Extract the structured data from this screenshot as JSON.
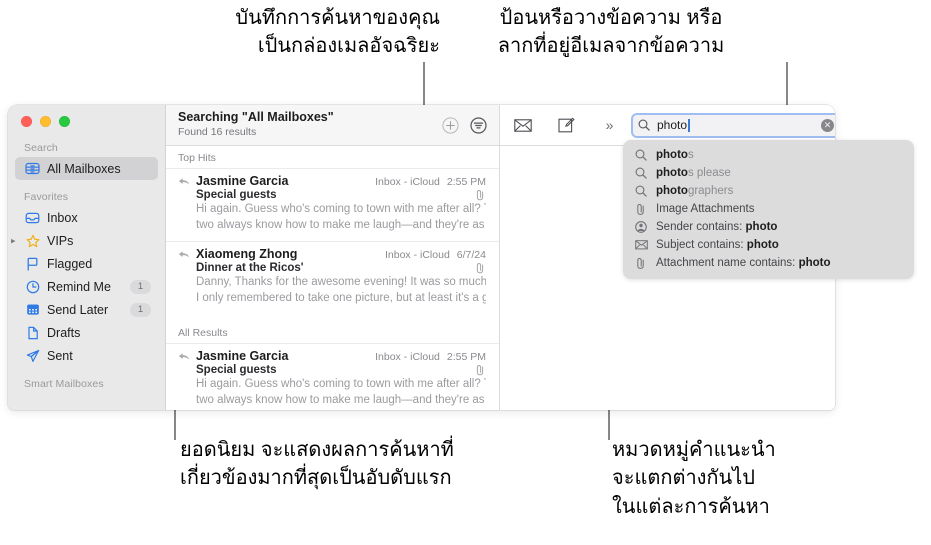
{
  "callouts": {
    "top_left": "บันทึกการค้นหาของคุณ\nเป็นกล่องเมลอัจฉริยะ",
    "top_right": "ป้อนหรือวางข้อความ หรือ\nลากที่อยู่อีเมลจากข้อความ",
    "bottom_left": "ยอดนิยม จะแสดงผลการค้นหาที่\nเกี่ยวข้องมากที่สุดเป็นอับดับแรก",
    "bottom_right": "หมวดหมู่คำแนะนำ\nจะแตกต่างกันไป\nในแต่ละการค้นหา"
  },
  "window": {
    "traffic_lights": [
      "close",
      "minimize",
      "zoom"
    ],
    "colors": {
      "accent_blue": "#2f7ae5",
      "focus_ring": "#9fbdf0",
      "sidebar_bg": "#e9e9e9",
      "selected_row": "#d2d2d4",
      "popup_bg": "#dcdcdc",
      "traffic_red": "#ff5f57",
      "traffic_yellow": "#febc2e",
      "traffic_green": "#28c840"
    }
  },
  "sidebar": {
    "sections": [
      {
        "header": "Search",
        "items": [
          {
            "label": "All Mailboxes",
            "icon": "mailbox-stack-icon",
            "selected": true,
            "badge": "",
            "disclosure": false
          }
        ]
      },
      {
        "header": "Favorites",
        "items": [
          {
            "label": "Inbox",
            "icon": "inbox-tray-icon",
            "selected": false,
            "badge": "",
            "disclosure": false
          },
          {
            "label": "VIPs",
            "icon": "star-icon",
            "selected": false,
            "badge": "",
            "disclosure": true
          },
          {
            "label": "Flagged",
            "icon": "flag-icon",
            "selected": false,
            "badge": "",
            "disclosure": false
          },
          {
            "label": "Remind Me",
            "icon": "clock-icon",
            "selected": false,
            "badge": "1",
            "disclosure": false
          },
          {
            "label": "Send Later",
            "icon": "calendar-icon",
            "selected": false,
            "badge": "1",
            "disclosure": false
          },
          {
            "label": "Drafts",
            "icon": "document-icon",
            "selected": false,
            "badge": "",
            "disclosure": false
          },
          {
            "label": "Sent",
            "icon": "paper-plane-icon",
            "selected": false,
            "badge": "",
            "disclosure": false
          }
        ]
      },
      {
        "header": "Smart Mailboxes",
        "items": []
      }
    ]
  },
  "list_header": {
    "title": "Searching \"All Mailboxes\"",
    "subtitle": "Found 16 results",
    "buttons": [
      {
        "name": "save-search-button",
        "icon": "plus-circle-icon"
      },
      {
        "name": "filter-button",
        "icon": "filter-circle-icon"
      }
    ]
  },
  "message_list": {
    "groups": [
      {
        "header": "Top Hits",
        "messages": [
          {
            "from": "Jasmine Garcia",
            "mailbox": "Inbox - iCloud",
            "time": "2:55 PM",
            "subject": "Special guests",
            "has_attachment": true,
            "preview_line1": "Hi again. Guess who's coming to town with me after all? These",
            "preview_line2": "two always know how to make me laugh—and they're as insepa…"
          },
          {
            "from": "Xiaomeng Zhong",
            "mailbox": "Inbox - iCloud",
            "time": "6/7/24",
            "subject": "Dinner at the Ricos'",
            "has_attachment": true,
            "preview_line1": "Danny, Thanks for the awesome evening! It was so much fun that",
            "preview_line2": "I only remembered to take one picture, but at least it's a good…"
          }
        ]
      },
      {
        "header": "All Results",
        "messages": [
          {
            "from": "Jasmine Garcia",
            "mailbox": "Inbox - iCloud",
            "time": "2:55 PM",
            "subject": "Special guests",
            "has_attachment": true,
            "preview_line1": "Hi again. Guess who's coming to town with me after all? These",
            "preview_line2": "two always know how to make me laugh—and they're as insepa…"
          }
        ]
      }
    ]
  },
  "toolbar": {
    "buttons": [
      {
        "name": "get-mail-button",
        "icon": "envelope-icon"
      },
      {
        "name": "compose-button",
        "icon": "compose-square-pencil-icon"
      },
      {
        "name": "more-toolbar-items-button",
        "icon": "chevron-double-right-icon"
      }
    ],
    "search": {
      "value": "photo",
      "placeholder": "Search",
      "icon": "search-icon",
      "clear_icon": "clear-circle-icon"
    }
  },
  "suggestions": [
    {
      "icon": "search-icon",
      "typed": "photo",
      "completion": "s",
      "suffix": "",
      "kind": "completion"
    },
    {
      "icon": "search-icon",
      "typed": "photo",
      "completion": "s",
      "suffix": " please",
      "kind": "completion"
    },
    {
      "icon": "search-icon",
      "typed": "photo",
      "completion": "graphers",
      "suffix": "",
      "kind": "completion"
    },
    {
      "icon": "paperclip-icon",
      "label": "Image Attachments",
      "kind": "category"
    },
    {
      "icon": "person-circle-icon",
      "label": "Sender contains:",
      "term": "photo",
      "kind": "token"
    },
    {
      "icon": "envelope-icon",
      "label": "Subject contains:",
      "term": "photo",
      "kind": "token"
    },
    {
      "icon": "paperclip-icon",
      "label": "Attachment name contains:",
      "term": "photo",
      "kind": "token"
    }
  ]
}
